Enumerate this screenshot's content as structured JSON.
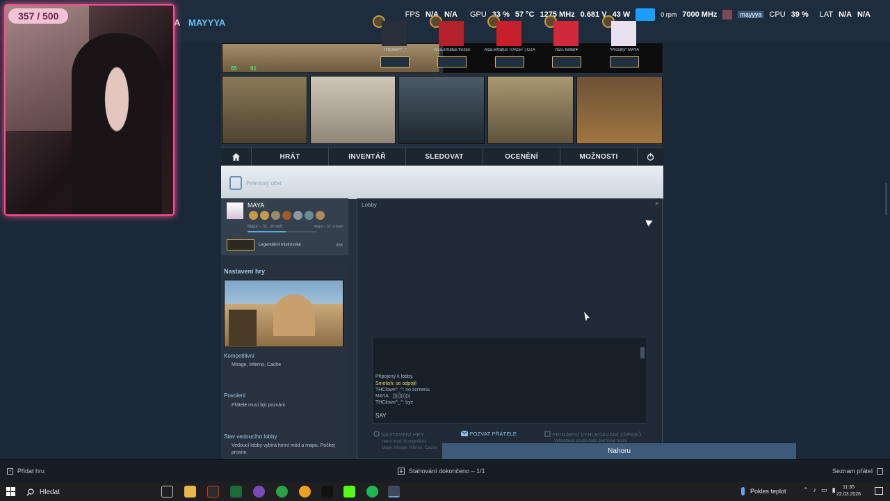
{
  "topbar": {
    "username_prefix": "A",
    "username": "MAYYYA",
    "perf": {
      "fps_label": "FPS",
      "fps_val1": "N/A",
      "fps_val2": "N/A",
      "gpu_label": "GPU",
      "gpu_load": "33 %",
      "gpu_temp": "57 °C",
      "gpu_clock": "1275 MHz",
      "gpu_volt": "0.681 V",
      "gpu_power": "43 W",
      "fan_rpm": "0 rpm",
      "mem_clock": "7000 MHz",
      "cpu_label": "CPU",
      "cpu_load": "39 %",
      "lat_label": "LAT",
      "lat_val1": "N/A",
      "lat_val2": "N/A",
      "user_chip": "mayyya"
    }
  },
  "webcam": {
    "counter": "357 / 500"
  },
  "thumbnails": {
    "hud_health": "65",
    "hud_armor": "91"
  },
  "nav": {
    "items": [
      "HRÁT",
      "INVENTÁŘ",
      "SLEDOVAT",
      "OCENĚNÍ",
      "MOŽNOSTI"
    ]
  },
  "banner": {
    "rank_text": "Prémiový účet"
  },
  "profile": {
    "name": "MAYA",
    "level_text": "Major – 31. úroveň",
    "level_text_right": "Major – 32. úroveň",
    "xp_progress": 0.55,
    "rank_name": "Legendární mistrovská",
    "trophy_count": "466"
  },
  "settings": {
    "header": "Nastavení hry",
    "competitive_label": "Kompetitivní",
    "competitive_maps": "Mirage, Inferno, Cache",
    "permission_label": "Povolení",
    "permission_value": "Přátelé musí být pozváni",
    "leader_label": "Stav vedoucího lobby",
    "leader_value": "Vedoucí lobby vybírá herní mód a mapu. Počkej prosím."
  },
  "lobby": {
    "title": "Lobby",
    "close": "×",
    "members": [
      {
        "name": "THClown^_^",
        "color": "#2a2d3a"
      },
      {
        "name": "Alza.eXtatus frozen",
        "color": "#b5212a"
      },
      {
        "name": "Alza.eXtatus TrAGeT | G2A",
        "color": "#c8202a"
      },
      {
        "name": "h5S. bellar♥",
        "color": "#d02a3a"
      },
      {
        "name": "*Prosíky* MAYA",
        "color": "#e8e0f0"
      }
    ],
    "chat": {
      "lines": [
        {
          "text": "Připojený k lobby.",
          "style": "normal"
        },
        {
          "text": "Smetish: se odpojil",
          "style": "yellow"
        },
        {
          "text": "THClown^_^: no screenu",
          "style": "normal"
        },
        {
          "text": "MAYA: :)))))))))))",
          "style": "normal"
        },
        {
          "text": "THClown^_^: bye",
          "style": "normal"
        }
      ],
      "input_label": "SAY"
    },
    "actions": {
      "settings": "NASTAVENÍ HRY",
      "invite": "POZVAT PŘÁTELE",
      "primary": "PRIMÁRNÍ VYHLEDÁVÁNÍ ZÁPASŮ"
    },
    "mode_info": {
      "mode_label": "Herní mód:",
      "mode_value": "Kompetitivní",
      "maps_label": "Mapy:",
      "maps_value": "Mirage, Inferno, Cache"
    },
    "pref_info": "Vyhledávat pouze další prémiové hráče"
  },
  "nahoru": "Nahoru",
  "steambar": {
    "add_game": "Přidat hru",
    "download": "Stahování dokončeno – 1/1",
    "friends": "Seznam přátel"
  },
  "taskbar": {
    "search": "Hledat",
    "weather": "Pokles teplot",
    "time": "11:35",
    "date": "22.03.2026"
  }
}
